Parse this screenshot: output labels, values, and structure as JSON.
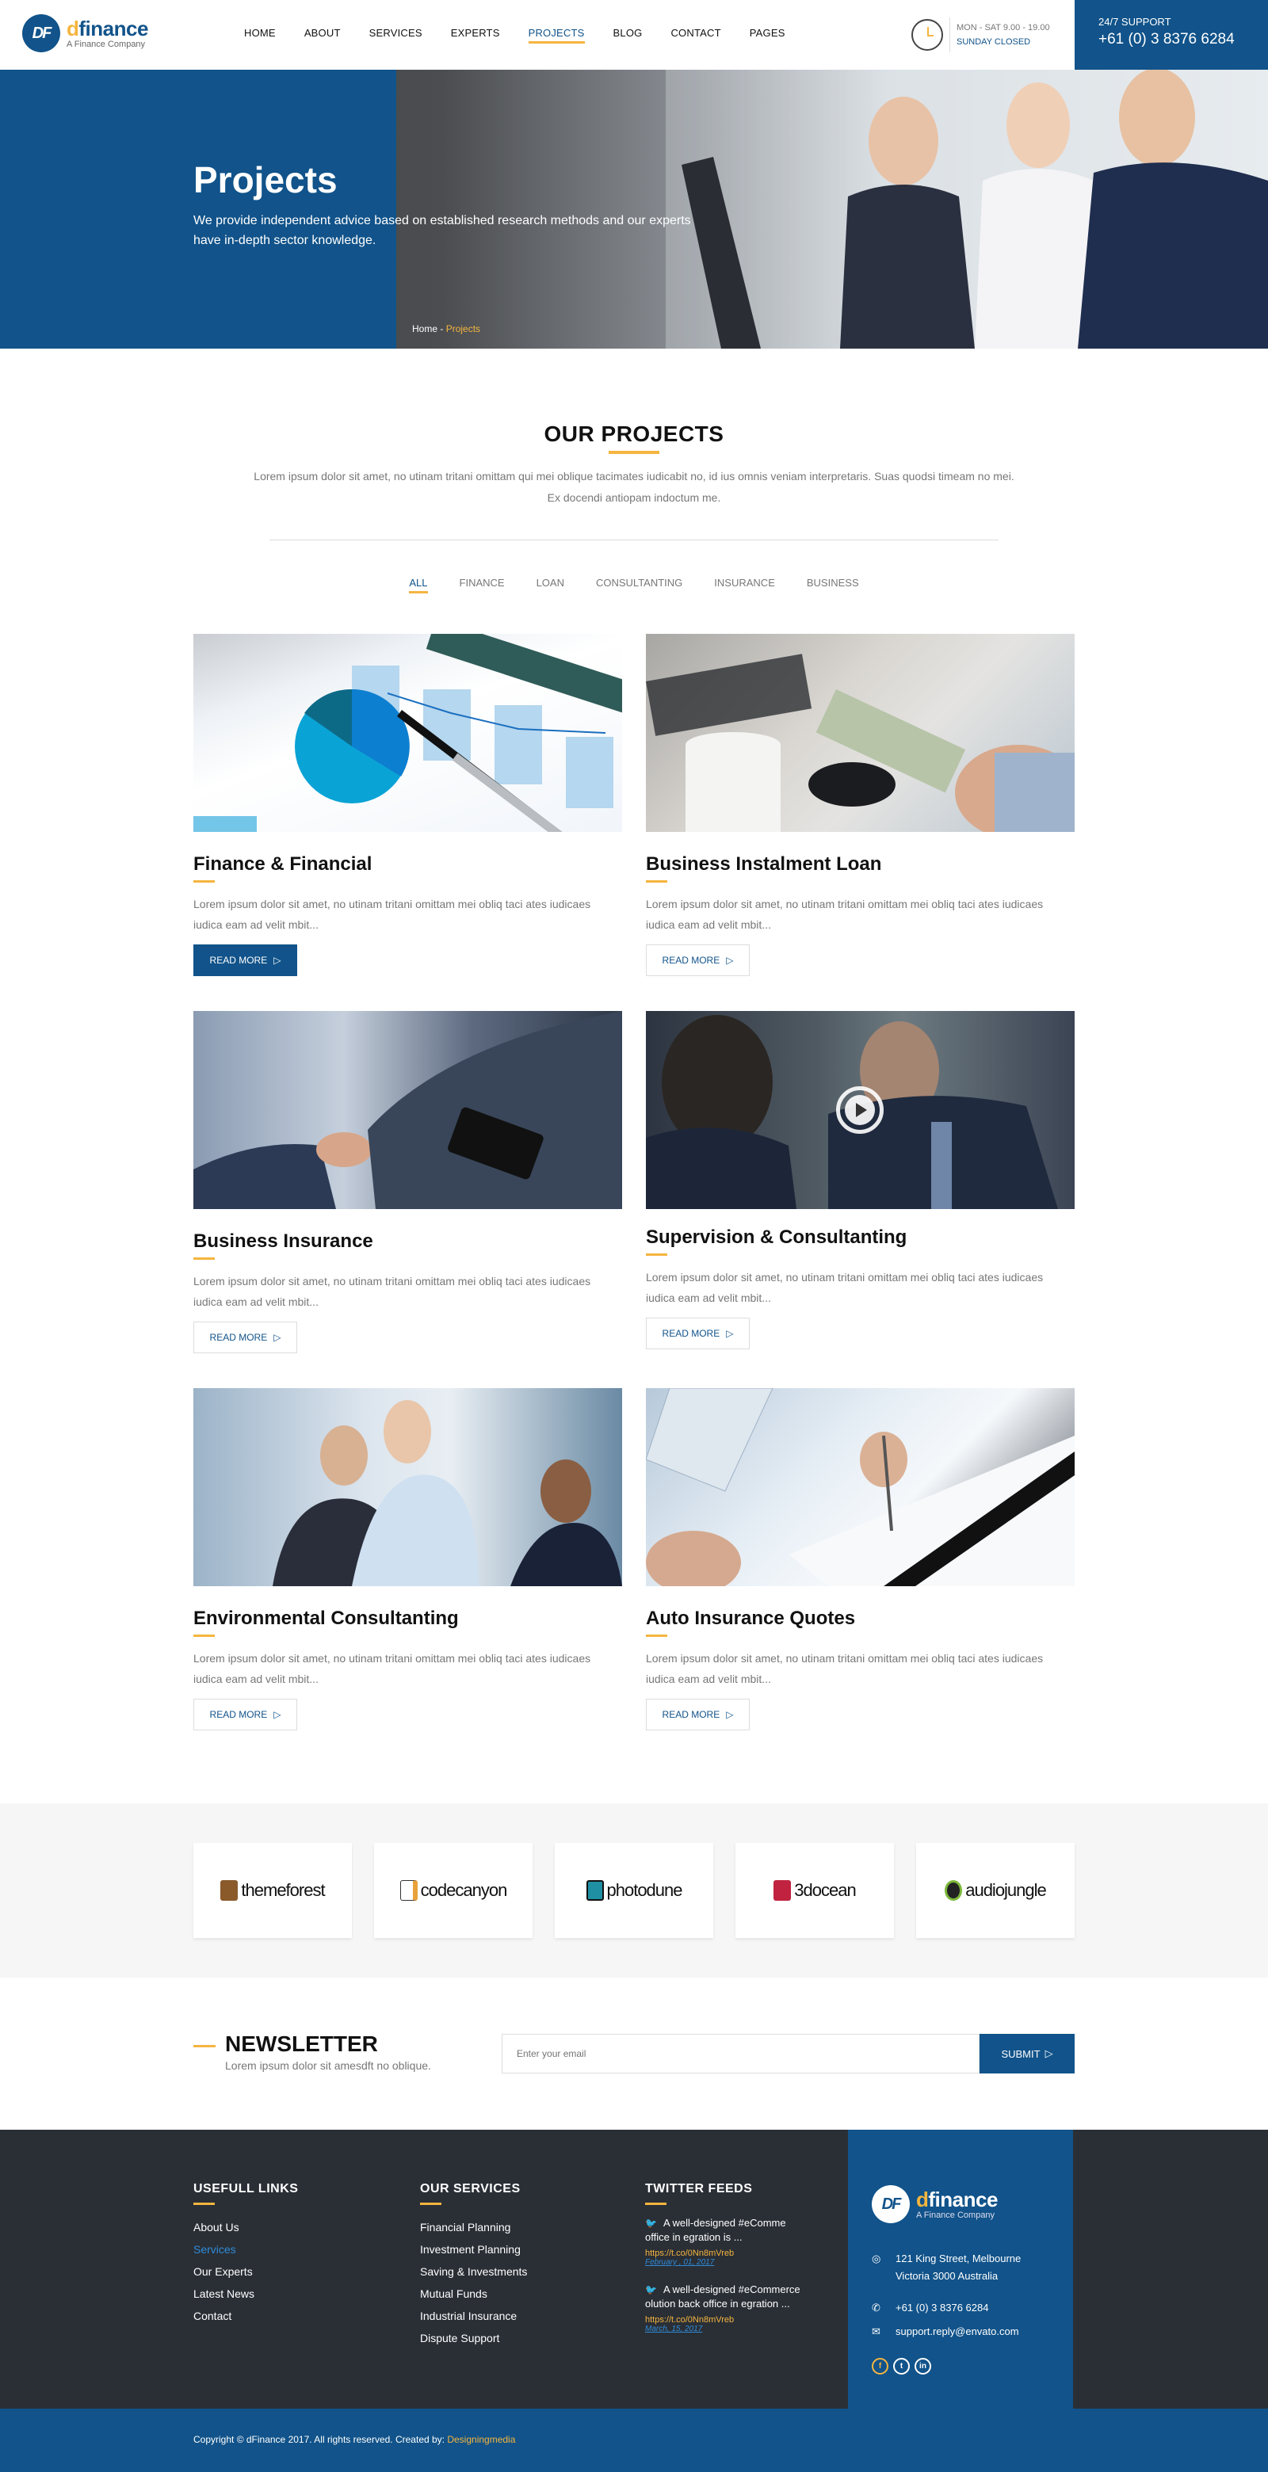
{
  "brand": {
    "letter_d": "d",
    "name_rest": "finance",
    "tagline": "A Finance Company",
    "monogram": "DF"
  },
  "nav": [
    {
      "label": "HOME",
      "active": false
    },
    {
      "label": "ABOUT",
      "active": false
    },
    {
      "label": "SERVICES",
      "active": false
    },
    {
      "label": "EXPERTS",
      "active": false
    },
    {
      "label": "PROJECTS",
      "active": true
    },
    {
      "label": "BLOG",
      "active": false
    },
    {
      "label": "CONTACT",
      "active": false
    },
    {
      "label": "PAGES",
      "active": false
    }
  ],
  "hours": {
    "line1": "MON - SAT 9.00 - 19.00",
    "line2": "SUNDAY CLOSED",
    "icon": "clock-icon"
  },
  "support": {
    "label": "24/7 SUPPORT",
    "phone": "+61 (0) 3 8376 6284"
  },
  "hero": {
    "title": "Projects",
    "description": "We provide independent advice based on established research methods and our experts have in-depth sector knowledge.",
    "breadcrumb": {
      "home": "Home",
      "separator": " - ",
      "current": "Projects"
    }
  },
  "projects_section": {
    "title": "OUR PROJECTS",
    "description": "Lorem ipsum dolor sit amet, no utinam tritani omittam qui mei oblique tacimates iudicabit no, id ius omnis veniam interpretaris. Suas quodsi timeam no mei. Ex docendi antiopam indoctum me.",
    "filters": [
      {
        "label": "ALL",
        "active": true
      },
      {
        "label": "FINANCE",
        "active": false
      },
      {
        "label": "LOAN",
        "active": false
      },
      {
        "label": "CONSULTANTING",
        "active": false
      },
      {
        "label": "INSURANCE",
        "active": false
      },
      {
        "label": "BUSINESS",
        "active": false
      }
    ],
    "cards": [
      {
        "title": "Finance & Financial",
        "desc": "Lorem ipsum dolor sit amet, no utinam tritani omittam mei obliq taci ates iudicaes iudica eam ad velit mbit...",
        "button": "READ MORE",
        "primary": true,
        "image": "summary-report-chart"
      },
      {
        "title": "Business Instalment Loan",
        "desc": "Lorem ipsum dolor sit amet, no utinam tritani omittam mei obliq taci ates iudicaes iudica eam ad velit mbit...",
        "button": "READ MORE",
        "primary": false,
        "image": "cash-counting"
      },
      {
        "title": "Business Insurance",
        "desc": "Lorem ipsum dolor sit amet, no utinam tritani omittam mei obliq taci ates iudicaes iudica eam ad velit mbit...",
        "button": "READ MORE",
        "primary": false,
        "image": "handshake"
      },
      {
        "title": "Supervision & Consultanting",
        "desc": "Lorem ipsum dolor sit amet, no utinam tritani omittam mei obliq taci ates iudicaes iudica eam ad velit mbit...",
        "button": "READ MORE",
        "primary": false,
        "image": "business-meeting-video"
      },
      {
        "title": "Environmental Consultanting",
        "desc": "Lorem ipsum dolor sit amet, no utinam tritani omittam mei obliq taci ates iudicaes iudica eam ad velit mbit...",
        "button": "READ MORE",
        "primary": false,
        "image": "team-discussion"
      },
      {
        "title": "Auto Insurance Quotes",
        "desc": "Lorem ipsum dolor sit amet, no utinam tritani omittam mei obliq taci ates iudicaes iudica eam ad velit mbit...",
        "button": "READ MORE",
        "primary": false,
        "image": "signing-document"
      }
    ]
  },
  "partners": [
    {
      "name": "themeforest",
      "color": "#8a5a2b"
    },
    {
      "name": "codecanyon",
      "color": "#e9a23b"
    },
    {
      "name": "photodune",
      "color": "#1f8fa3"
    },
    {
      "name": "3docean",
      "color": "#c0223f"
    },
    {
      "name": "audiojungle",
      "color": "#7cb83a"
    }
  ],
  "newsletter": {
    "title": "NEWSLETTER",
    "subtitle": "Lorem ipsum dolor sit amesdft no oblique.",
    "placeholder": "Enter your email",
    "submit": "SUBMIT"
  },
  "footer": {
    "useful_links": {
      "title": "USEFULL LINKS",
      "items": [
        {
          "label": "About Us",
          "active": false
        },
        {
          "label": "Services",
          "active": true
        },
        {
          "label": "Our Experts",
          "active": false
        },
        {
          "label": "Latest News",
          "active": false
        },
        {
          "label": "Contact",
          "active": false
        }
      ]
    },
    "services": {
      "title": "OUR SERVICES",
      "items": [
        "Financial Planning",
        "Investment Planning",
        "Saving & Investments",
        "Mutual Funds",
        "Industrial Insurance",
        "Dispute Support"
      ]
    },
    "twitter": {
      "title": "TWITTER FEEDS",
      "tweets": [
        {
          "text": "A well-designed #eComme office in egration is ...",
          "link": "https://t.co/0Nn8mVreb",
          "date": "February , 01, 2017"
        },
        {
          "text": "A well-designed #eCommerce olution back office in egration ...",
          "link": "https://t.co/0Nn8mVreb",
          "date": "March, 15, 2017"
        }
      ]
    },
    "contact": {
      "address_line1": "121 King Street, Melbourne",
      "address_line2": "Victoria 3000 Australia",
      "phone": "+61 (0) 3 8376 6284",
      "email": "support.reply@envato.com",
      "socials": [
        {
          "name": "facebook",
          "glyph": "f"
        },
        {
          "name": "twitter",
          "glyph": "t"
        },
        {
          "name": "linkedin",
          "glyph": "in"
        }
      ]
    }
  },
  "copyright": {
    "text": "Copyright © dFinance 2017. All rights reserved. Created by: ",
    "author": "Designingmedia"
  },
  "colors": {
    "primary": "#11538a",
    "accent": "#f5b53f",
    "footer_bg": "#2a2f36",
    "link_blue": "#2f8bd8"
  }
}
